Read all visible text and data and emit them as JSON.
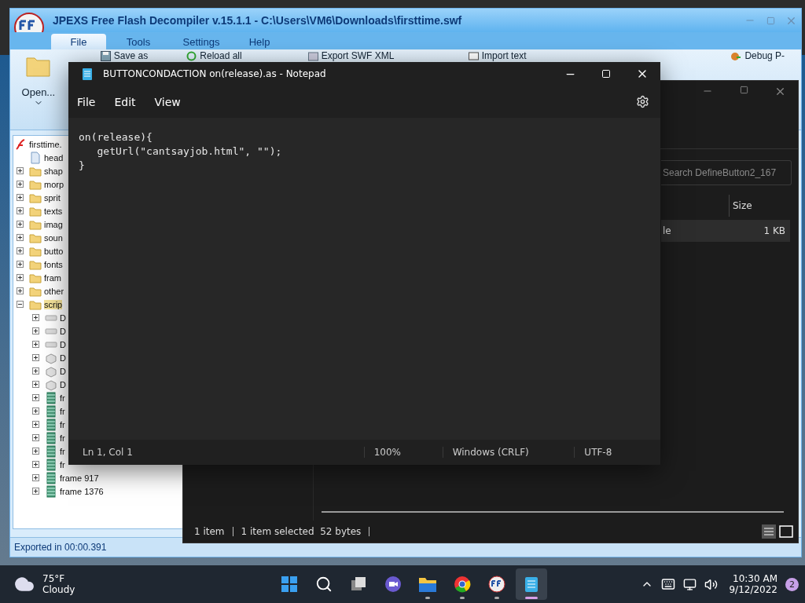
{
  "ffdec": {
    "title": "JPEXS Free Flash Decompiler v.15.1.1 - C:\\Users\\VM6\\Downloads\\firsttime.swf",
    "menu_tabs": [
      {
        "label": "File",
        "selected": true
      },
      {
        "label": "Tools",
        "selected": false
      },
      {
        "label": "Settings",
        "selected": false
      },
      {
        "label": "Help",
        "selected": false
      }
    ],
    "ribbon": [
      {
        "kind": "big",
        "label": "Open..."
      },
      {
        "kind": "small",
        "label": "Save as"
      },
      {
        "kind": "small",
        "label": "Reload all"
      },
      {
        "kind": "small",
        "label": "Export SWF XML"
      },
      {
        "kind": "small",
        "label": "Import text"
      },
      {
        "kind": "small",
        "label": "Debug P-"
      }
    ],
    "tree": [
      {
        "label": "firsttime.",
        "kind": "swf",
        "selected": false,
        "children": [
          {
            "label": "head",
            "kind": "doc",
            "selected": false
          },
          {
            "label": "shap",
            "kind": "folder",
            "selected": false,
            "expanded": false
          },
          {
            "label": "morp",
            "kind": "folder",
            "selected": false,
            "expanded": false
          },
          {
            "label": "sprit",
            "kind": "folder",
            "selected": false,
            "expanded": false
          },
          {
            "label": "texts",
            "kind": "folder",
            "selected": false,
            "expanded": false
          },
          {
            "label": "imag",
            "kind": "folder",
            "selected": false,
            "expanded": false
          },
          {
            "label": "soun",
            "kind": "folder",
            "selected": false,
            "expanded": false
          },
          {
            "label": "butto",
            "kind": "folder",
            "selected": false,
            "expanded": false
          },
          {
            "label": "fonts",
            "kind": "folder",
            "selected": false,
            "expanded": false
          },
          {
            "label": "fram",
            "kind": "folder",
            "selected": false,
            "expanded": false
          },
          {
            "label": "other",
            "kind": "folder",
            "selected": false,
            "expanded": false
          },
          {
            "label": "scrip",
            "kind": "folder",
            "selected": true,
            "expanded": true,
            "children": [
              {
                "label": "D",
                "kind": "button",
                "selected": false,
                "expanded": false
              },
              {
                "label": "D",
                "kind": "button",
                "selected": false,
                "expanded": false
              },
              {
                "label": "D",
                "kind": "button",
                "selected": false,
                "expanded": false
              },
              {
                "label": "D",
                "kind": "sprite",
                "selected": false,
                "expanded": false
              },
              {
                "label": "D",
                "kind": "sprite",
                "selected": false,
                "expanded": false
              },
              {
                "label": "D",
                "kind": "sprite",
                "selected": false,
                "expanded": false
              },
              {
                "label": "fr",
                "kind": "frame",
                "selected": false,
                "expanded": false
              },
              {
                "label": "fr",
                "kind": "frame",
                "selected": false,
                "expanded": false
              },
              {
                "label": "fr",
                "kind": "frame",
                "selected": false,
                "expanded": false
              },
              {
                "label": "fr",
                "kind": "frame",
                "selected": false,
                "expanded": false
              },
              {
                "label": "fr",
                "kind": "frame",
                "selected": false,
                "expanded": false
              },
              {
                "label": "fr",
                "kind": "frame",
                "selected": false,
                "expanded": false
              },
              {
                "label": "frame 917",
                "kind": "frame",
                "selected": false,
                "expanded": false
              },
              {
                "label": "frame 1376",
                "kind": "frame",
                "selected": false,
                "expanded": false
              }
            ]
          }
        ]
      }
    ],
    "status": "Exported in 00:00.391"
  },
  "explorer": {
    "search": {
      "placeholder": "Search DefineButton2_167"
    },
    "columns": [
      "Size"
    ],
    "rows": [
      {
        "column_1": "le",
        "size": "1 KB",
        "selected": true
      }
    ],
    "status": [
      "1 item",
      "1 item selected  52 bytes"
    ]
  },
  "notepad": {
    "title": "BUTTONCONDACTION on(release).as - Notepad",
    "menu": [
      "File",
      "Edit",
      "View"
    ],
    "code": [
      "on(release){",
      "   getUrl(\"cantsayjob.html\", \"\");",
      "}"
    ],
    "status": [
      "Ln 1, Col 1",
      "100%",
      "Windows (CRLF)",
      "UTF-8"
    ]
  },
  "taskbar": {
    "weather": {
      "temperature": "75°F",
      "condition": "Cloudy"
    },
    "apps": [
      {
        "kind": "start",
        "running": false,
        "active": false
      },
      {
        "kind": "search",
        "running": false,
        "active": false
      },
      {
        "kind": "taskview",
        "running": false,
        "active": false
      },
      {
        "kind": "chat",
        "running": false,
        "active": false
      },
      {
        "kind": "explorer",
        "running": true,
        "active": false
      },
      {
        "kind": "chrome",
        "running": true,
        "active": false
      },
      {
        "kind": "ffdec",
        "running": true,
        "active": false
      },
      {
        "kind": "notepad",
        "running": true,
        "active": true
      }
    ],
    "time": "10:30 AM",
    "date": "9/12/2022",
    "badge": "2"
  }
}
